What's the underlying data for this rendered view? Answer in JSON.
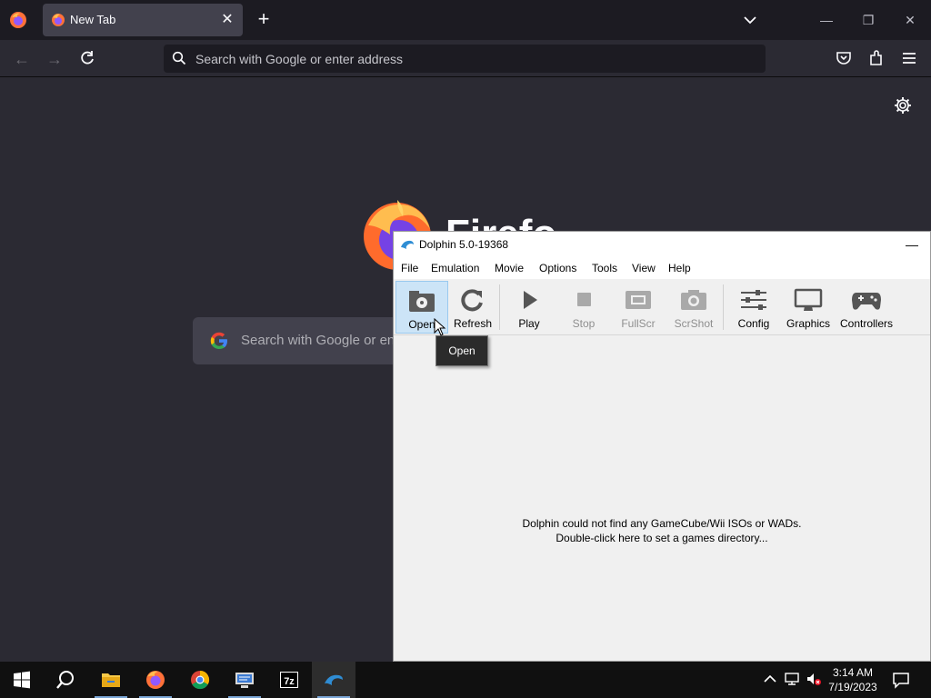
{
  "browser": {
    "tab": {
      "title": "New Tab"
    },
    "urlbar": {
      "placeholder": "Search with Google or enter address"
    },
    "newtab": {
      "wordmark": "Firefo",
      "search_placeholder": "Search with Google or en"
    }
  },
  "dolphin": {
    "title": "Dolphin 5.0-19368",
    "menu": [
      "File",
      "Emulation",
      "Movie",
      "Options",
      "Tools",
      "View",
      "Help"
    ],
    "toolbar": [
      {
        "label": "Open",
        "icon": "open-icon",
        "state": "hover"
      },
      {
        "label": "Refresh",
        "icon": "refresh-icon",
        "state": "enabled"
      },
      {
        "label": "Play",
        "icon": "play-icon",
        "state": "enabled"
      },
      {
        "label": "Stop",
        "icon": "stop-icon",
        "state": "disabled"
      },
      {
        "label": "FullScr",
        "icon": "fullscreen-icon",
        "state": "disabled"
      },
      {
        "label": "ScrShot",
        "icon": "screenshot-icon",
        "state": "disabled"
      },
      {
        "label": "Config",
        "icon": "config-icon",
        "state": "enabled"
      },
      {
        "label": "Graphics",
        "icon": "graphics-icon",
        "state": "enabled"
      },
      {
        "label": "Controllers",
        "icon": "controllers-icon",
        "state": "enabled"
      }
    ],
    "tooltip": "Open",
    "empty_message": {
      "line1": "Dolphin could not find any GameCube/Wii ISOs or WADs.",
      "line2": "Double-click here to set a games directory..."
    }
  },
  "taskbar": {
    "apps": [
      "start-icon",
      "search-icon",
      "file-explorer-icon",
      "firefox-icon",
      "chrome-icon",
      "network-app-icon",
      "7zip-icon",
      "dolphin-icon"
    ],
    "clock": {
      "time": "3:14 AM",
      "date": "7/19/2023"
    }
  }
}
